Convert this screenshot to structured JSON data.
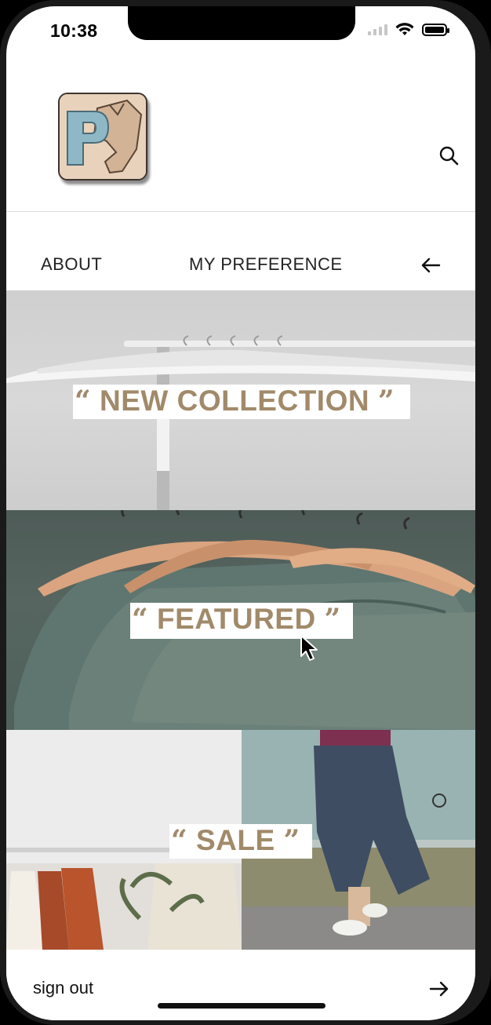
{
  "status_bar": {
    "time": "10:38"
  },
  "header": {
    "logo_icon": "brand-logo-p",
    "search_icon": "search-icon"
  },
  "nav": {
    "about_label": "ABOUT",
    "preference_label": "MY PREFERENCE",
    "back_icon": "arrow-left-icon"
  },
  "collections": [
    {
      "label": "NEW COLLECTION"
    },
    {
      "label": "FEATURED"
    },
    {
      "label": "SALE"
    }
  ],
  "quote_open": "“",
  "quote_close": "”",
  "footer": {
    "signout_label": "sign out",
    "forward_icon": "arrow-right-icon"
  },
  "colors": {
    "accent": "#a18a6a",
    "logo_bg": "#e8d2bc",
    "logo_blue": "#8fb8c6"
  }
}
